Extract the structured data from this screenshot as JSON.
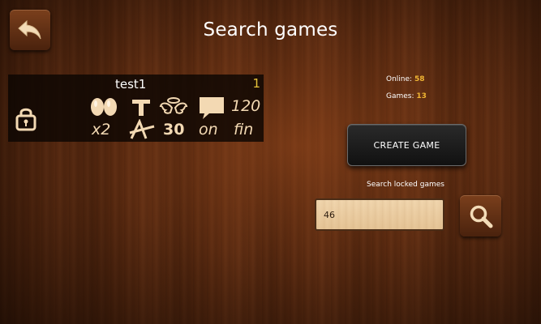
{
  "header": {
    "title": "Search games"
  },
  "game_list": [
    {
      "name": "test1",
      "number": "1",
      "locked": true,
      "options": {
        "count": "120",
        "multiplier": "x2",
        "time": "30",
        "mode": "on",
        "ending": "fin"
      }
    }
  ],
  "stats": {
    "online_label": "Online:",
    "online_value": "58",
    "games_label": "Games:",
    "games_value": "13"
  },
  "create_button_label": "CREATE GAME",
  "search": {
    "label": "Search locked games",
    "value": "46"
  },
  "colors": {
    "accent_yellow": "#f0b533",
    "option_cream": "#f3d9b3",
    "wood_dark": "#5a2a10"
  },
  "icons": [
    "back-arrow-icon",
    "lock-icon",
    "eggs-icon",
    "letter-t-icon",
    "wings-icon",
    "speech-bubble-icon",
    "crossed-a-icon",
    "magnifier-icon"
  ]
}
